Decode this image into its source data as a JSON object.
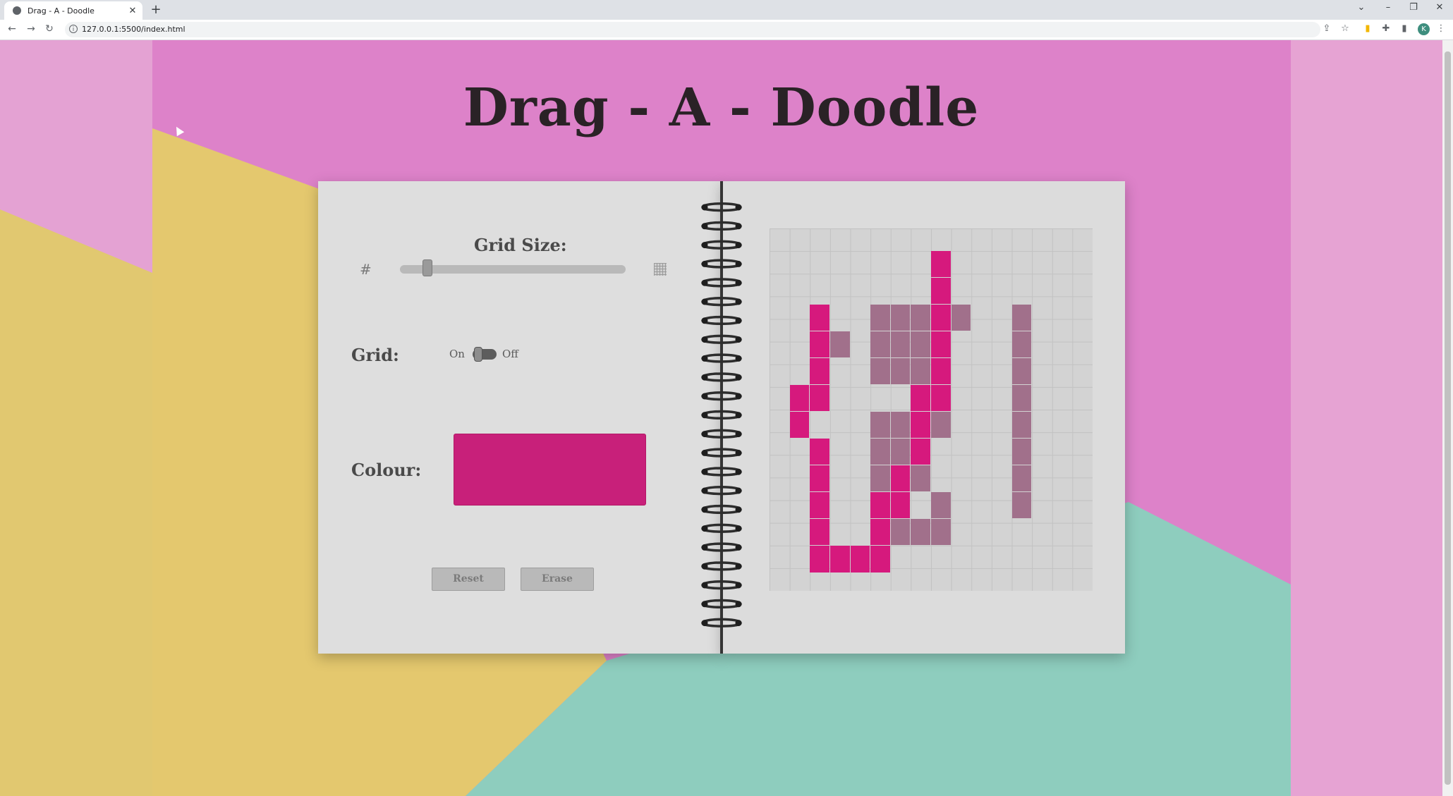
{
  "browser": {
    "tab_title": "Drag - A - Doodle",
    "tab_close": "✕",
    "new_tab": "+",
    "url": "127.0.0.1:5500/index.html",
    "min": "–",
    "restore": "❐",
    "close": "✕",
    "chevron": "⌄",
    "back": "←",
    "forward": "→",
    "reload": "↻",
    "share": "⇪",
    "star": "☆",
    "puzzle": "✚",
    "sidepanel": "▮",
    "menu": "⋮",
    "avatar_letter": "K"
  },
  "app": {
    "title": "Drag - A - Doodle",
    "grid_size_label": "Grid Size:",
    "grid_size_min_icon": "#",
    "grid_size_value": 0.1,
    "grid_label": "Grid:",
    "grid_on": "On",
    "grid_off": "Off",
    "grid_state": "on",
    "colour_label": "Colour:",
    "colour_value": "#c8207a",
    "reset_label": "Reset",
    "erase_label": "Erase"
  },
  "canvas": {
    "cols": 16,
    "rows": 12,
    "pink": "#d6197d",
    "mauve": "#a1708b",
    "cells": [
      [
        8,
        1,
        "pink"
      ],
      [
        8,
        2,
        "pink"
      ],
      [
        2,
        3,
        "pink"
      ],
      [
        5,
        3,
        "mauve"
      ],
      [
        6,
        3,
        "mauve"
      ],
      [
        7,
        3,
        "mauve"
      ],
      [
        8,
        3,
        "pink"
      ],
      [
        9,
        3,
        "mauve"
      ],
      [
        12,
        3,
        "mauve"
      ],
      [
        2,
        4,
        "pink"
      ],
      [
        3,
        4,
        "mauve"
      ],
      [
        5,
        4,
        "mauve"
      ],
      [
        6,
        4,
        "mauve"
      ],
      [
        7,
        4,
        "mauve"
      ],
      [
        8,
        4,
        "pink"
      ],
      [
        12,
        4,
        "mauve"
      ],
      [
        2,
        5,
        "pink"
      ],
      [
        5,
        5,
        "mauve"
      ],
      [
        6,
        5,
        "mauve"
      ],
      [
        7,
        5,
        "mauve"
      ],
      [
        8,
        5,
        "pink"
      ],
      [
        12,
        5,
        "mauve"
      ],
      [
        1,
        6,
        "pink"
      ],
      [
        2,
        6,
        "pink"
      ],
      [
        7,
        6,
        "pink"
      ],
      [
        8,
        6,
        "pink"
      ],
      [
        12,
        6,
        "mauve"
      ],
      [
        1,
        7,
        "pink"
      ],
      [
        5,
        7,
        "mauve"
      ],
      [
        6,
        7,
        "mauve"
      ],
      [
        7,
        7,
        "pink"
      ],
      [
        8,
        7,
        "mauve"
      ],
      [
        12,
        7,
        "mauve"
      ],
      [
        2,
        8,
        "pink"
      ],
      [
        5,
        8,
        "mauve"
      ],
      [
        6,
        8,
        "mauve"
      ],
      [
        7,
        8,
        "pink"
      ],
      [
        12,
        8,
        "mauve"
      ],
      [
        2,
        9,
        "pink"
      ],
      [
        5,
        9,
        "mauve"
      ],
      [
        6,
        9,
        "pink"
      ],
      [
        7,
        9,
        "mauve"
      ],
      [
        12,
        9,
        "mauve"
      ],
      [
        2,
        10,
        "pink"
      ],
      [
        5,
        10,
        "pink"
      ],
      [
        6,
        10,
        "pink"
      ],
      [
        8,
        10,
        "mauve"
      ],
      [
        12,
        10,
        "mauve"
      ],
      [
        2,
        11,
        "pink"
      ],
      [
        5,
        11,
        "pink"
      ],
      [
        6,
        11,
        "mauve"
      ],
      [
        7,
        11,
        "mauve"
      ],
      [
        8,
        11,
        "mauve"
      ],
      [
        2,
        12,
        "pink"
      ],
      [
        3,
        12,
        "pink"
      ],
      [
        4,
        12,
        "pink"
      ],
      [
        5,
        12,
        "pink"
      ]
    ]
  }
}
